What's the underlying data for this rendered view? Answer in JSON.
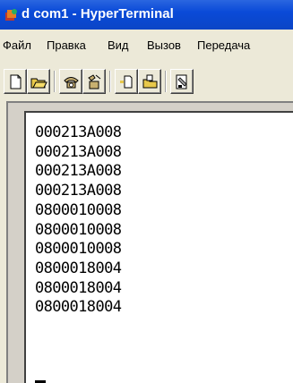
{
  "window": {
    "title": "d com1 - HyperTerminal"
  },
  "menu": [
    "Файл",
    "Правка",
    "Вид",
    "Вызов",
    "Передача"
  ],
  "toolbar": [
    {
      "name": "new-document-icon"
    },
    {
      "name": "open-folder-icon"
    },
    {
      "name": "connect-phone-icon"
    },
    {
      "name": "disconnect-phone-icon"
    },
    {
      "name": "send-file-icon"
    },
    {
      "name": "receive-file-icon"
    },
    {
      "name": "properties-icon"
    }
  ],
  "terminal": {
    "lines": [
      "000213A008",
      "000213A008",
      "000213A008",
      "000213A008",
      "0800010008",
      "0800010008",
      "0800010008",
      "0800018004",
      "0800018004",
      "0800018004"
    ]
  },
  "colors": {
    "titlebar": "#0a4ad8",
    "menubar": "#ece9d8",
    "terminal_bg": "#ffffff"
  }
}
